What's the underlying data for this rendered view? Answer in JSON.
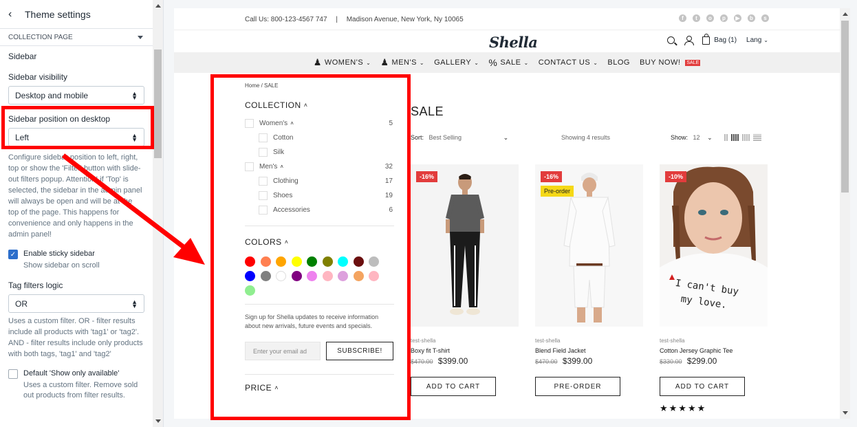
{
  "panel": {
    "title": "Theme settings",
    "section": "COLLECTION PAGE",
    "sidebar_title": "Sidebar",
    "visibility_label": "Sidebar visibility",
    "visibility_value": "Desktop and mobile",
    "position_label": "Sidebar position on desktop",
    "position_value": "Left",
    "position_help": "Configure sidebar position to left, right, top or show the 'Filter' button with slide-out filters popup. Attention! if 'Top' is selected, the sidebar in the admin panel will always be open and will be at the top of the page. This happens for convenience and only happens in the admin panel!",
    "sticky_label": "Enable sticky sidebar",
    "sticky_help": "Show sidebar on scroll",
    "tag_logic_label": "Tag filters logic",
    "tag_logic_value": "OR",
    "tag_logic_help": "Uses a custom filter. OR - filter results include all products with 'tag1' or 'tag2'. AND - filter results include only products with both tags, 'tag1' and 'tag2'",
    "available_label": "Default 'Show only available'",
    "available_help": "Uses a custom filter. Remove sold out products from filter results."
  },
  "store": {
    "contact": "Call Us: 800-123-4567 747",
    "address": "Madison Avenue, New York, Ny 10065",
    "logo": "Shella",
    "bag": "Bag (1)",
    "lang": "Lang",
    "nav": [
      "WOMEN'S",
      "MEN'S",
      "GALLERY",
      "SALE",
      "CONTACT US",
      "BLOG",
      "BUY NOW!"
    ],
    "nav_badge": "SALE"
  },
  "sidebar": {
    "breadcrumb": "Home  /  SALE",
    "collection_head": "COLLECTION",
    "items": [
      {
        "label": "Women's",
        "count": "5",
        "indent": false,
        "expand": true
      },
      {
        "label": "Cotton",
        "count": "",
        "indent": true
      },
      {
        "label": "Silk",
        "count": "",
        "indent": true
      },
      {
        "label": "Men's",
        "count": "32",
        "indent": false,
        "expand": true
      },
      {
        "label": "Clothing",
        "count": "17",
        "indent": true
      },
      {
        "label": "Shoes",
        "count": "19",
        "indent": true
      },
      {
        "label": "Accessories",
        "count": "6",
        "indent": true
      }
    ],
    "colors_head": "COLORS",
    "colors": [
      "#ff0000",
      "#ff7f50",
      "#ffa500",
      "#ffff00",
      "#008000",
      "#808000",
      "#00ffff",
      "#6b0f0f",
      "#bdbdbd",
      "#0000ff",
      "#808080",
      "#ffffff",
      "#800080",
      "#ee82ee",
      "#ffb6c1",
      "#dda0dd",
      "#f4a460",
      "#ffb6c1",
      "#90ee90"
    ],
    "signup": "Sign up for Shella updates to receive information about new arrivals, future events and specials.",
    "email_placeholder": "Enter your email ad",
    "subscribe": "SUBSCRIBE!",
    "price_head": "PRICE"
  },
  "catalog": {
    "title": "SALE",
    "sort_label": "Sort:",
    "sort_value": "Best Selling",
    "showing": "Showing 4 results",
    "show_label": "Show:",
    "show_value": "12",
    "products": [
      {
        "badge": "-16%",
        "badge2": "",
        "vendor": "test-shella",
        "name": "Boxy fit T-shirt",
        "old": "$470.00",
        "price": "$399.00",
        "button": "ADD TO CART",
        "stars": ""
      },
      {
        "badge": "-16%",
        "badge2": "Pre-order",
        "vendor": "test-shella",
        "name": "Blend Field Jacket",
        "old": "$470.00",
        "price": "$399.00",
        "button": "PRE-ORDER",
        "stars": ""
      },
      {
        "badge": "-10%",
        "badge2": "",
        "vendor": "test-shella",
        "name": "Cotton Jersey Graphic Tee",
        "old": "$330.00",
        "price": "$299.00",
        "button": "ADD TO CART",
        "stars": "★★★★★"
      }
    ]
  }
}
